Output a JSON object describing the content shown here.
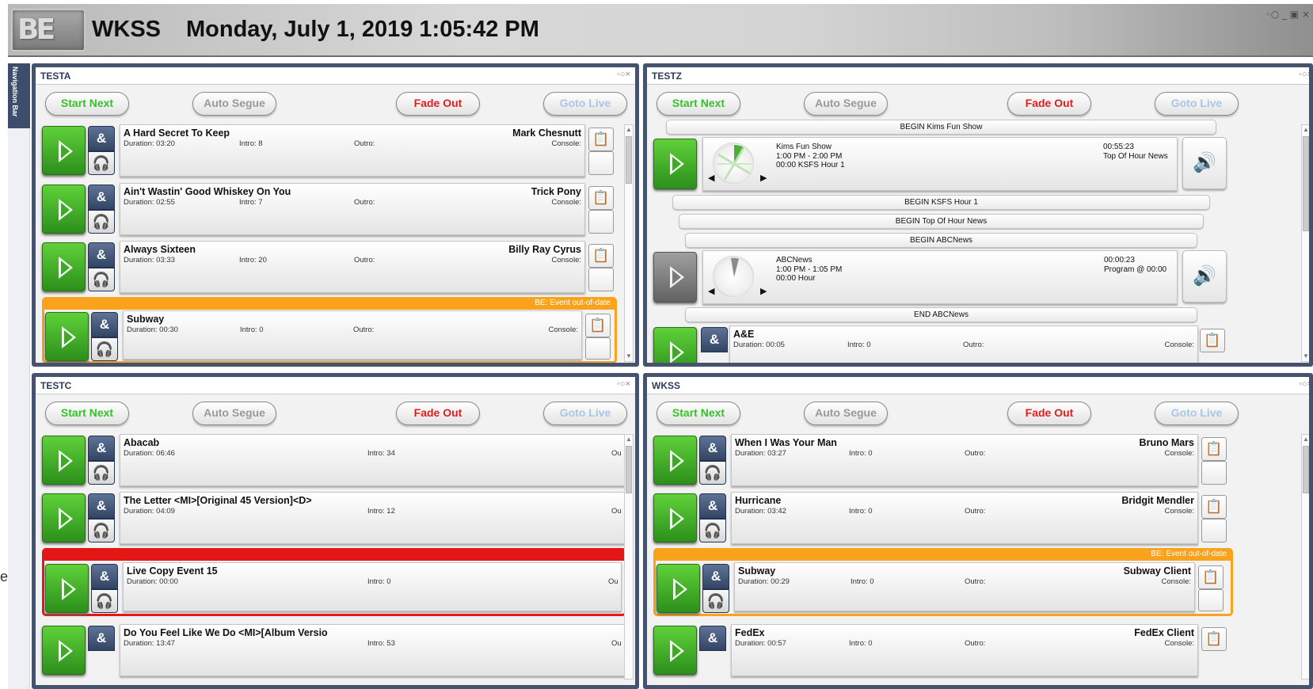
{
  "header": {
    "logo_text": "BE",
    "station": "WKSS",
    "datetime": "Monday, July 1, 2019 1:05:42 PM",
    "window_controls": "◦○  _ ▣ ×"
  },
  "nav": {
    "label": "Navigation Bar",
    "clipped_text": "e"
  },
  "panel_controls": "◦○×",
  "buttons": {
    "start_next": "Start Next",
    "auto_segue": "Auto Segue",
    "fade_out": "Fade Out",
    "goto_live": "Goto Live"
  },
  "icons": {
    "amp": "&",
    "headphones": "🎧",
    "clipboard": "📋",
    "speaker": "🔊",
    "left": "◀",
    "right": "▶",
    "up": "▲",
    "down": "▼"
  },
  "panels": {
    "testa": {
      "name": "TESTA",
      "rows": [
        {
          "title": "A Hard Secret To Keep",
          "duration": "Duration: 03:20",
          "intro": "Intro: 8",
          "outro": "Outro:",
          "artist": "Mark Chesnutt",
          "console": "Console:"
        },
        {
          "title": "Ain't Wastin' Good Whiskey On You",
          "duration": "Duration: 02:55",
          "intro": "Intro: 7",
          "outro": "Outro:",
          "artist": "Trick Pony",
          "console": "Console:"
        },
        {
          "title": "Always Sixteen",
          "duration": "Duration: 03:33",
          "intro": "Intro: 20",
          "outro": "Outro:",
          "artist": "Billy Ray Cyrus",
          "console": "Console:"
        },
        {
          "title": "Subway",
          "duration": "Duration: 00:30",
          "intro": "Intro: 0",
          "outro": "Outro:",
          "artist": "",
          "console": "Console:"
        }
      ],
      "warning": "BE: Event out-of-date"
    },
    "testz": {
      "name": "TESTZ",
      "segments": [
        "BEGIN Kims Fun Show",
        "BEGIN KSFS Hour 1",
        "BEGIN Top Of Hour News",
        "BEGIN ABCNews",
        "END ABCNews"
      ],
      "shows": [
        {
          "line1": "Kims Fun Show",
          "line2": "1:00 PM - 2:00 PM",
          "line3": "00:00 KSFS Hour 1",
          "time": "00:55:23",
          "right": "Top Of Hour News",
          "progress": 0.08
        },
        {
          "line1": "ABCNews",
          "line2": "1:00 PM - 1:05 PM",
          "line3": "00:00 Hour",
          "time": "00:00:23",
          "right": "Program @ 00:00",
          "progress": 0.95
        }
      ],
      "rows": [
        {
          "title": "A&E",
          "duration": "Duration: 00:05",
          "intro": "Intro: 0",
          "outro": "Outro:",
          "console": "Console:"
        }
      ]
    },
    "testc": {
      "name": "TESTC",
      "rows": [
        {
          "title": "Abacab",
          "duration": "Duration: 06:46",
          "intro": "Intro: 34",
          "outro": "Ou"
        },
        {
          "title": "The Letter <MI>[Original 45 Version]<D>",
          "duration": "Duration: 04:09",
          "intro": "Intro: 12",
          "outro": "Ou"
        },
        {
          "title": "Live Copy Event 15",
          "duration": "Duration: 00:00",
          "intro": "Intro: 0",
          "outro": "Ou"
        },
        {
          "title": "Do You Feel Like We Do <MI>[Album Versio",
          "duration": "Duration: 13:47",
          "intro": "Intro: 53",
          "outro": "Ou"
        }
      ]
    },
    "wkss": {
      "name": "WKSS",
      "rows": [
        {
          "title": "When I Was Your Man",
          "duration": "Duration: 03:27",
          "intro": "Intro: 0",
          "outro": "Outro:",
          "artist": "Bruno Mars",
          "console": "Console:"
        },
        {
          "title": "Hurricane",
          "duration": "Duration: 03:42",
          "intro": "Intro: 0",
          "outro": "Outro:",
          "artist": "Bridgit Mendler",
          "console": "Console:"
        },
        {
          "title": "Subway",
          "duration": "Duration: 00:29",
          "intro": "Intro: 0",
          "outro": "Outro:",
          "artist": "Subway Client",
          "console": "Console:"
        },
        {
          "title": "FedEx",
          "duration": "Duration: 00:57",
          "intro": "Intro: 0",
          "outro": "Outro:",
          "artist": "FedEx Client",
          "console": "Console:"
        }
      ],
      "warning": "BE: Event out-of-date"
    }
  },
  "colors": {
    "accent_green": "#36c02a",
    "fade_red": "#e21c1c",
    "warning_orange": "#f9a21b",
    "alert_red": "#e51616",
    "panel_border": "#46536f"
  }
}
